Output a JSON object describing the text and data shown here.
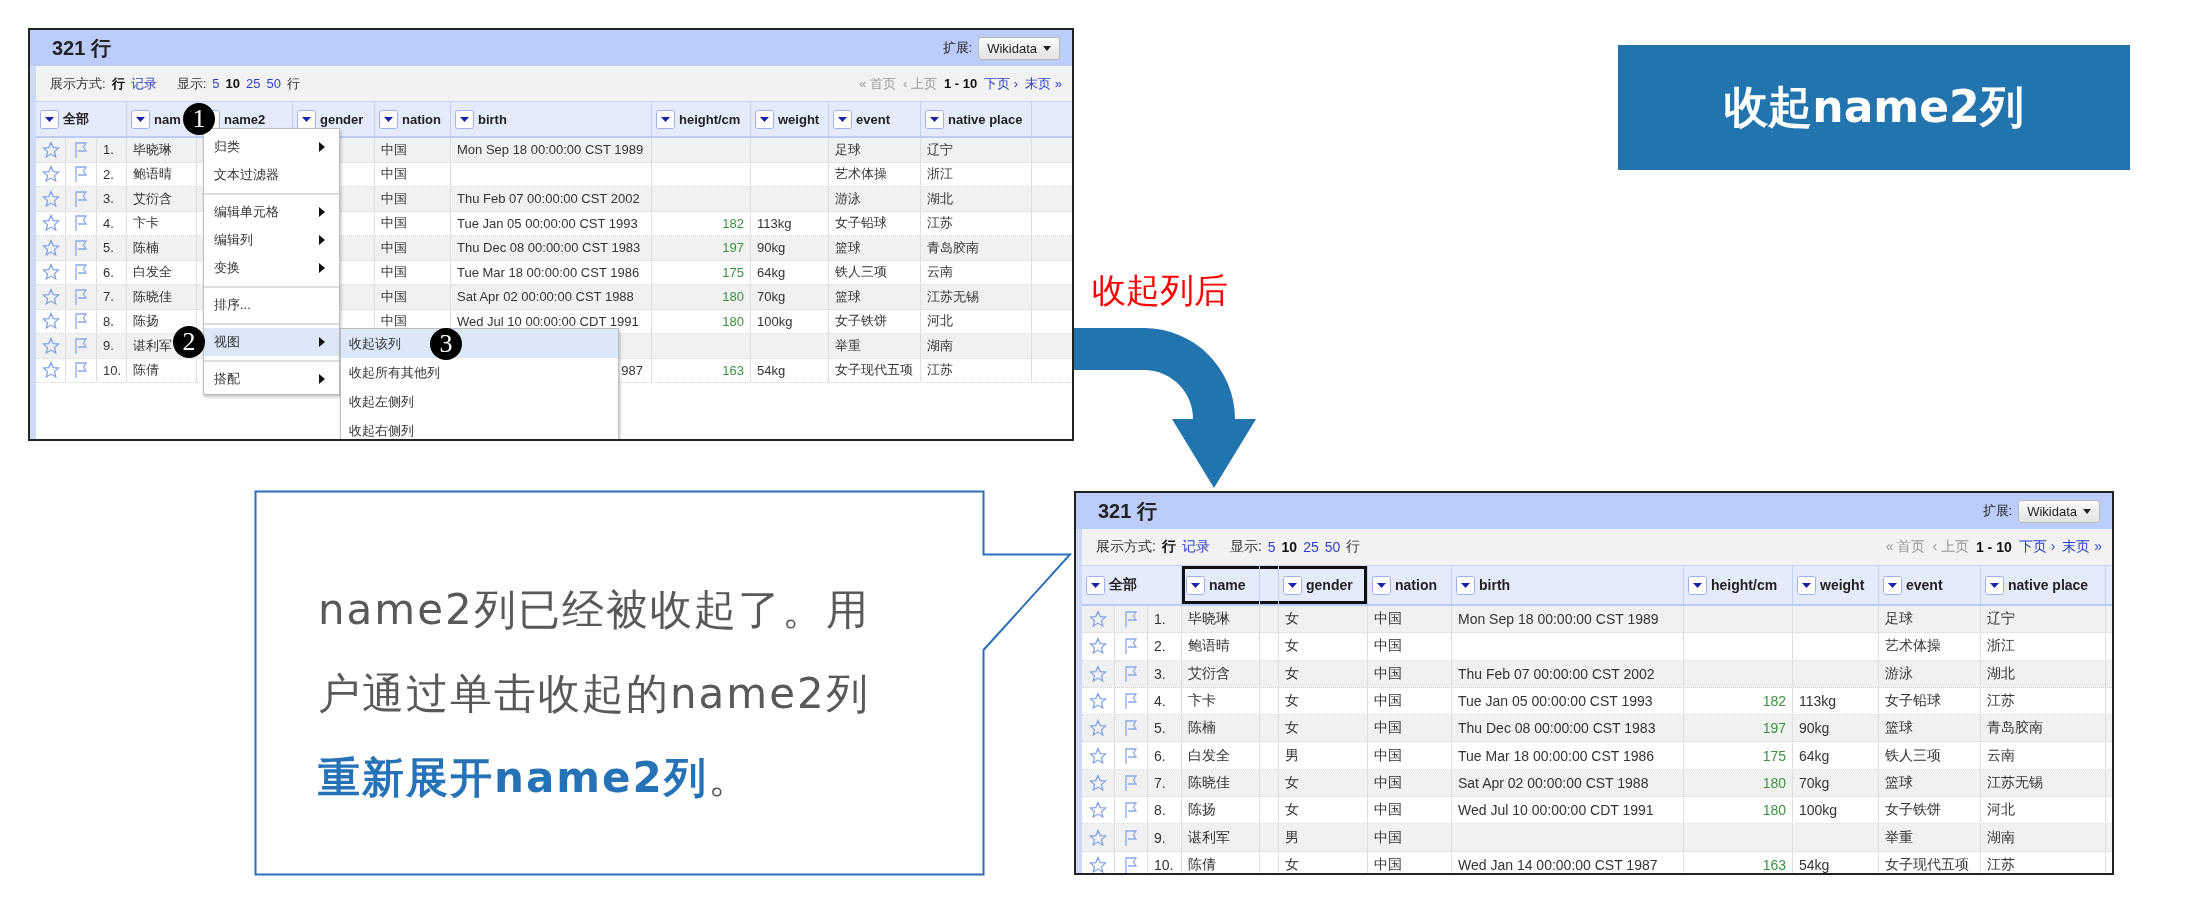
{
  "title_box": {
    "text": "收起name2列"
  },
  "arrow_label": "收起列后",
  "callout": {
    "text": "name2列已经被收起了。用户通过单击收起的name2列**重新展开name2列**。"
  },
  "left_screen": {
    "row_count": "321 行",
    "extension_label": "扩展:",
    "extension_button": "Wikidata",
    "view_label": "展示方式:",
    "view_modes": [
      {
        "label": "行",
        "selected": true
      },
      {
        "label": "记录",
        "selected": false
      }
    ],
    "show_label": "显示:",
    "page_sizes": [
      {
        "label": "5",
        "selected": false
      },
      {
        "label": "10",
        "selected": true
      },
      {
        "label": "25",
        "selected": false
      },
      {
        "label": "50",
        "selected": false
      }
    ],
    "show_unit": "行",
    "pager": [
      {
        "kind": "link",
        "label": "« 首页",
        "disabled": true
      },
      {
        "kind": "link",
        "label": "‹ 上页",
        "disabled": true
      },
      {
        "kind": "range",
        "label": "1 - 10"
      },
      {
        "kind": "link",
        "label": "下页 ›",
        "disabled": false
      },
      {
        "kind": "link",
        "label": "末页 »",
        "disabled": false
      }
    ],
    "all_column": "全部",
    "columns": [
      {
        "kind": "text",
        "label": "nam",
        "badge": "1"
      },
      {
        "kind": "text",
        "label": "name2"
      },
      {
        "kind": "text",
        "label": "gender"
      },
      {
        "kind": "text",
        "label": "nation"
      },
      {
        "kind": "text",
        "label": "birth"
      },
      {
        "kind": "number",
        "label": "height/cm"
      },
      {
        "kind": "text",
        "label": "weight"
      },
      {
        "kind": "text",
        "label": "event"
      },
      {
        "kind": "text",
        "label": "native place"
      }
    ],
    "rows": [
      {
        "index": "1.",
        "cells": [
          "毕晓琳",
          null,
          null,
          "中国",
          "Mon Sep 18 00:00:00 CST 1989",
          null,
          null,
          "足球",
          "辽宁"
        ]
      },
      {
        "index": "2.",
        "cells": [
          "鲍语晴",
          null,
          null,
          "中国",
          null,
          null,
          null,
          "艺术体操",
          "浙江"
        ]
      },
      {
        "index": "3.",
        "cells": [
          "艾衍含",
          null,
          null,
          "中国",
          "Thu Feb 07 00:00:00 CST 2002",
          null,
          null,
          "游泳",
          "湖北"
        ]
      },
      {
        "index": "4.",
        "cells": [
          "卞卡",
          null,
          null,
          "中国",
          "Tue Jan 05 00:00:00 CST 1993",
          "182",
          "113kg",
          "女子铅球",
          "江苏"
        ]
      },
      {
        "index": "5.",
        "cells": [
          "陈楠",
          null,
          null,
          "中国",
          "Thu Dec 08 00:00:00 CST 1983",
          "197",
          "90kg",
          "篮球",
          "青岛胶南"
        ]
      },
      {
        "index": "6.",
        "cells": [
          "白发全",
          null,
          null,
          "中国",
          "Tue Mar 18 00:00:00 CST 1986",
          "175",
          "64kg",
          "铁人三项",
          "云南"
        ]
      },
      {
        "index": "7.",
        "cells": [
          "陈晓佳",
          null,
          null,
          "中国",
          "Sat Apr 02 00:00:00 CST 1988",
          "180",
          "70kg",
          "篮球",
          "江苏无锡"
        ]
      },
      {
        "index": "8.",
        "cells": [
          "陈扬",
          null,
          null,
          "中国",
          "Wed Jul 10 00:00:00 CDT 1991",
          "180",
          "100kg",
          "女子铁饼",
          "河北"
        ]
      },
      {
        "index": "9.",
        "cells": [
          "谌利军",
          null,
          null,
          null,
          null,
          null,
          null,
          "举重",
          "湖南"
        ]
      },
      {
        "index": "10.",
        "cells": [
          "陈倩",
          null,
          null,
          null,
          {
            "text": "987",
            "cut": true
          },
          "163",
          "54kg",
          "女子现代五项",
          "江苏"
        ]
      }
    ],
    "menu": {
      "items": [
        {
          "kind": "item",
          "label": "归类",
          "has_submenu": true,
          "selected": false
        },
        {
          "kind": "item",
          "label": "文本过滤器",
          "has_submenu": false,
          "selected": false
        },
        {
          "kind": "separator"
        },
        {
          "kind": "item",
          "label": "编辑单元格",
          "has_submenu": true,
          "selected": false
        },
        {
          "kind": "item",
          "label": "编辑列",
          "has_submenu": true,
          "selected": false
        },
        {
          "kind": "item",
          "label": "变换",
          "has_submenu": true,
          "selected": false
        },
        {
          "kind": "separator"
        },
        {
          "kind": "item",
          "label": "排序...",
          "has_submenu": false,
          "selected": false
        },
        {
          "kind": "separator"
        },
        {
          "kind": "item",
          "label": "视图",
          "has_submenu": true,
          "selected": true,
          "badge": "2"
        },
        {
          "kind": "separator"
        },
        {
          "kind": "item",
          "label": "搭配",
          "has_submenu": true,
          "selected": false
        }
      ],
      "submenu": [
        {
          "label": "收起该列",
          "selected": true,
          "badge": "3"
        },
        {
          "label": "收起所有其他列",
          "selected": false
        },
        {
          "label": "收起左侧列",
          "selected": false
        },
        {
          "label": "收起右侧列",
          "selected": false
        }
      ]
    }
  },
  "right_screen": {
    "row_count": "321 行",
    "extension_label": "扩展:",
    "extension_button": "Wikidata",
    "view_label": "展示方式:",
    "view_modes": [
      {
        "label": "行",
        "selected": true
      },
      {
        "label": "记录",
        "selected": false
      }
    ],
    "show_label": "显示:",
    "page_sizes": [
      {
        "label": "5",
        "selected": false
      },
      {
        "label": "10",
        "selected": true
      },
      {
        "label": "25",
        "selected": false
      },
      {
        "label": "50",
        "selected": false
      }
    ],
    "show_unit": "行",
    "pager": [
      {
        "kind": "link",
        "label": "« 首页",
        "disabled": true
      },
      {
        "kind": "link",
        "label": "‹ 上页",
        "disabled": true
      },
      {
        "kind": "range",
        "label": "1 - 10"
      },
      {
        "kind": "link",
        "label": "下页 ›",
        "disabled": false
      },
      {
        "kind": "link",
        "label": "末页 »",
        "disabled": false
      }
    ],
    "all_column": "全部",
    "columns": [
      {
        "kind": "text",
        "label": "name",
        "highlighted": true
      },
      {
        "kind": "collapsed",
        "highlighted": true
      },
      {
        "kind": "text",
        "label": "gender",
        "highlighted": true
      },
      {
        "kind": "text",
        "label": "nation",
        "highlighted": false
      },
      {
        "kind": "text",
        "label": "birth",
        "highlighted": false
      },
      {
        "kind": "number",
        "label": "height/cm",
        "highlighted": false
      },
      {
        "kind": "text",
        "label": "weight",
        "highlighted": false
      },
      {
        "kind": "text",
        "label": "event",
        "highlighted": false
      },
      {
        "kind": "text",
        "label": "native place",
        "highlighted": false
      }
    ],
    "rows": [
      {
        "index": "1.",
        "cells": [
          "毕晓琳",
          null,
          "女",
          "中国",
          "Mon Sep 18 00:00:00 CST 1989",
          null,
          null,
          "足球",
          "辽宁"
        ]
      },
      {
        "index": "2.",
        "cells": [
          "鲍语晴",
          null,
          "女",
          "中国",
          null,
          null,
          null,
          "艺术体操",
          "浙江"
        ]
      },
      {
        "index": "3.",
        "cells": [
          "艾衍含",
          null,
          "女",
          "中国",
          "Thu Feb 07 00:00:00 CST 2002",
          null,
          null,
          "游泳",
          "湖北"
        ]
      },
      {
        "index": "4.",
        "cells": [
          "卞卡",
          null,
          "女",
          "中国",
          "Tue Jan 05 00:00:00 CST 1993",
          "182",
          "113kg",
          "女子铅球",
          "江苏"
        ]
      },
      {
        "index": "5.",
        "cells": [
          "陈楠",
          null,
          "女",
          "中国",
          "Thu Dec 08 00:00:00 CST 1983",
          "197",
          "90kg",
          "篮球",
          "青岛胶南"
        ]
      },
      {
        "index": "6.",
        "cells": [
          "白发全",
          null,
          "男",
          "中国",
          "Tue Mar 18 00:00:00 CST 1986",
          "175",
          "64kg",
          "铁人三项",
          "云南"
        ]
      },
      {
        "index": "7.",
        "cells": [
          "陈晓佳",
          null,
          "女",
          "中国",
          "Sat Apr 02 00:00:00 CST 1988",
          "180",
          "70kg",
          "篮球",
          "江苏无锡"
        ]
      },
      {
        "index": "8.",
        "cells": [
          "陈扬",
          null,
          "女",
          "中国",
          "Wed Jul 10 00:00:00 CDT 1991",
          "180",
          "100kg",
          "女子铁饼",
          "河北"
        ]
      },
      {
        "index": "9.",
        "cells": [
          "谌利军",
          null,
          "男",
          "中国",
          null,
          null,
          null,
          "举重",
          "湖南"
        ]
      },
      {
        "index": "10.",
        "cells": [
          "陈倩",
          null,
          "女",
          "中国",
          "Wed Jan 14 00:00:00 CST 1987",
          "163",
          "54kg",
          "女子现代五项",
          "江苏"
        ]
      }
    ]
  }
}
